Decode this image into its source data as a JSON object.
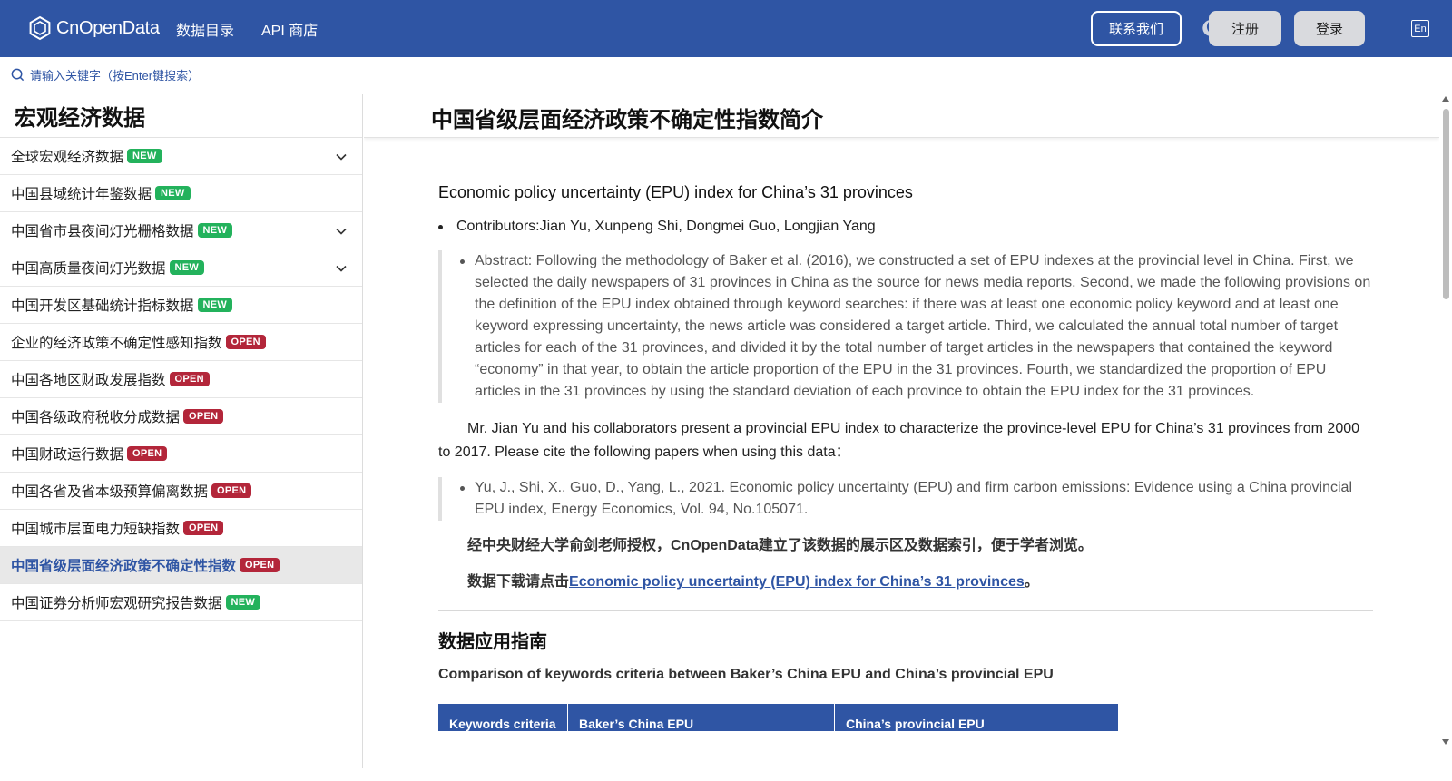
{
  "header": {
    "logo_text": "CnOpenData",
    "nav": [
      "数据目录",
      "API 商店"
    ],
    "contact": "联系我们",
    "register": "注册",
    "login": "登录",
    "lang": "En"
  },
  "search": {
    "placeholder": "请输入关键字（按Enter键搜索）"
  },
  "sidebar": {
    "title": "宏观经济数据",
    "items": [
      {
        "label": "全球宏观经济数据",
        "badge": "NEW"
      },
      {
        "label": "中国县域统计年鉴数据",
        "badge": "NEW"
      },
      {
        "label": "中国省市县夜间灯光栅格数据",
        "badge": "NEW"
      },
      {
        "label": "中国高质量夜间灯光数据",
        "badge": "NEW"
      },
      {
        "label": "中国开发区基础统计指标数据",
        "badge": "NEW"
      },
      {
        "label": "企业的经济政策不确定性感知指数",
        "badge": "OPEN"
      },
      {
        "label": "中国各地区财政发展指数",
        "badge": "OPEN"
      },
      {
        "label": "中国各级政府税收分成数据",
        "badge": "OPEN"
      },
      {
        "label": "中国财政运行数据",
        "badge": "OPEN"
      },
      {
        "label": "中国各省及省本级预算偏离数据",
        "badge": "OPEN"
      },
      {
        "label": "中国城市层面电力短缺指数",
        "badge": "OPEN"
      },
      {
        "label": "中国省级层面经济政策不确定性指数",
        "badge": "OPEN"
      },
      {
        "label": "中国证券分析师宏观研究报告数据",
        "badge": "NEW"
      }
    ]
  },
  "main": {
    "title": "中国省级层面经济政策不确定性指数简介",
    "heading": "Economic policy uncertainty (EPU) index for China’s 31 provinces",
    "contributors": "Contributors:Jian Yu, Xunpeng Shi, Dongmei Guo, Longjian Yang",
    "abstract": "Abstract: Following the methodology of Baker et al. (2016), we constructed a set of EPU indexes at the provincial level in China. First, we selected the daily newspapers of 31 provinces in China as the source for news media reports. Second, we made the following provisions on the definition of the EPU index obtained through keyword searches: if there was at least one economic policy keyword and at least one keyword expressing uncertainty, the news article was considered a target article. Third, we calculated the annual total number of target articles for each of the 31 provinces, and divided it by the total number of target articles in the newspapers that contained the keyword “economy” in that year, to obtain the article proportion of the EPU in the 31 provinces. Fourth, we standardized the proportion of EPU articles in the 31 provinces by using the standard deviation of each province to obtain the EPU index for the 31 provinces.",
    "intro": "Mr. Jian Yu and his collaborators present a provincial EPU index to characterize the province-level EPU for China’s 31 provinces from 2000 to 2017. Please cite the following papers when using this data：",
    "citation": "Yu, J., Shi, X., Guo, D., Yang, L., 2021. Economic policy uncertainty (EPU) and firm carbon emissions: Evidence using a China provincial EPU index, Energy Economics, Vol. 94, No.105071.",
    "auth": "经中央财经大学俞剑老师授权，CnOpenData建立了该数据的展示区及数据索引，便于学者浏览。",
    "download_prefix": "数据下载请点击",
    "download_link": "Economic policy uncertainty (EPU) index for China’s 31 provinces",
    "download_suffix": "。",
    "guide_title": "数据应用指南",
    "guide_sub": "Comparison of keywords criteria between Baker’s China EPU and China’s provincial EPU",
    "table_headers": [
      "Keywords criteria",
      "Baker’s China EPU",
      "China’s provincial EPU"
    ]
  },
  "colors": {
    "brand": "#2f55a4",
    "new_badge": "#23b25c",
    "open_badge": "#b3263a"
  }
}
